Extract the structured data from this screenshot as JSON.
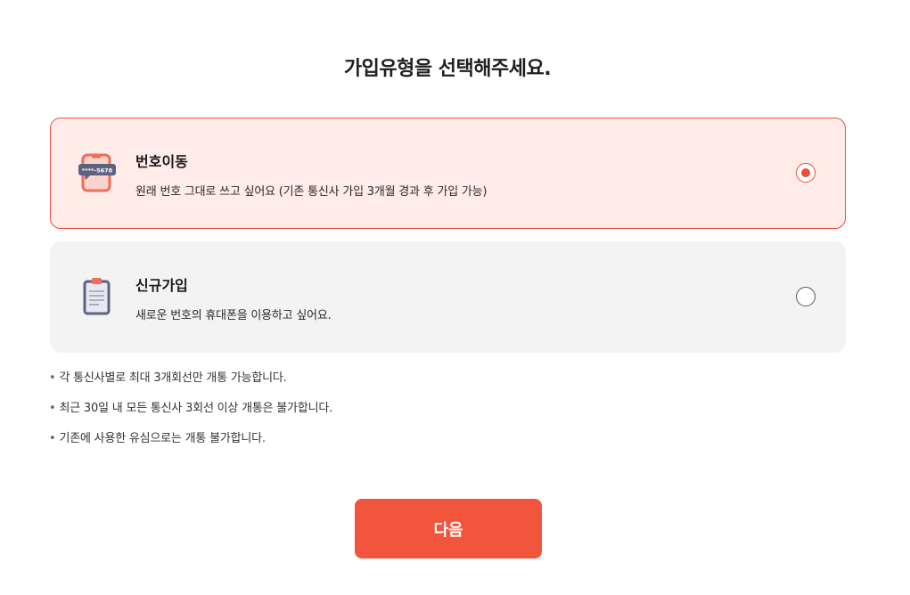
{
  "page": {
    "title": "가입유형을 선택해주세요."
  },
  "options": [
    {
      "title": "번호이동",
      "description": "원래 번호 그대로 쓰고 싶어요 (기존 통신사 가입 3개월 경과 후 가입 가능)",
      "icon": "phone-number-icon",
      "icon_text": "****-5678",
      "selected": true
    },
    {
      "title": "신규가입",
      "description": "새로운 번호의 휴대폰을 이용하고 싶어요.",
      "icon": "clipboard-icon",
      "selected": false
    }
  ],
  "notes": [
    "각 통신사별로 최대 3개회선만 개통 가능합니다.",
    "최근 30일 내 모든 통신사 3회선 이상 개통은 불가합니다.",
    "기존에 사용한 유심으로는 개통 불가합니다."
  ],
  "note_bullet": "•",
  "next_button": {
    "label": "다음"
  },
  "colors": {
    "accent": "#f1553b",
    "selected_border": "#e94f3a",
    "selected_bg": "#ffebe8",
    "unselected_bg": "#f3f3f3"
  }
}
